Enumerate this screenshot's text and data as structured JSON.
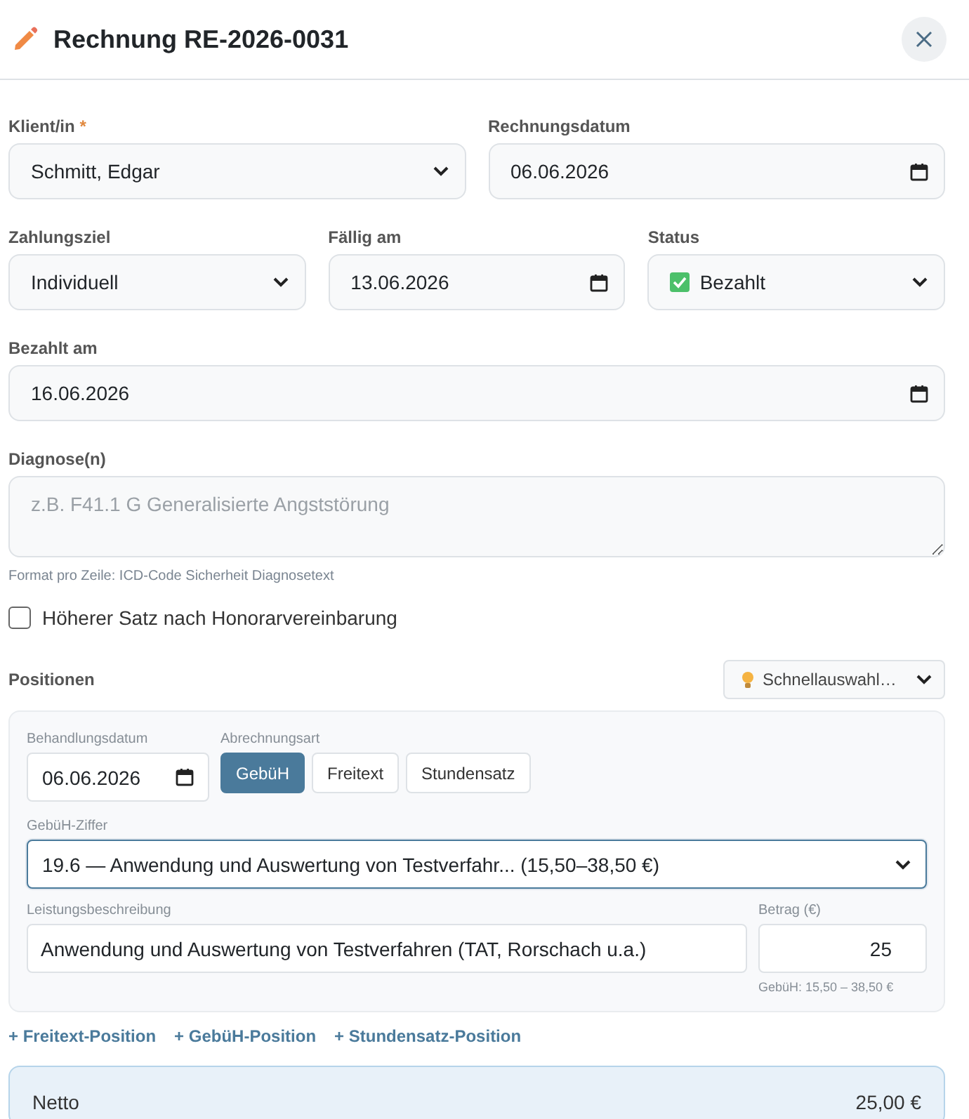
{
  "dialog": {
    "title": "Rechnung RE-2026-0031"
  },
  "required_marker": "*",
  "field_rows": [
    [
      {
        "label": "Klient/in",
        "required": true,
        "kind": "select",
        "value": "Schmitt, Edgar"
      },
      {
        "label": "Rechnungsdatum",
        "required": false,
        "kind": "date",
        "value": "06.06.2026"
      }
    ],
    [
      {
        "label": "Zahlungsziel",
        "required": false,
        "kind": "select",
        "value": "Individuell"
      },
      {
        "label": "Fällig am",
        "required": false,
        "kind": "date",
        "value": "13.06.2026"
      },
      {
        "label": "Status",
        "required": false,
        "kind": "status",
        "value": "Bezahlt"
      }
    ],
    [
      {
        "label": "Bezahlt am",
        "required": false,
        "kind": "date",
        "value": "16.06.2026"
      }
    ]
  ],
  "diagnosis": {
    "label": "Diagnose(n)",
    "placeholder": "z.B. F41.1 G Generalisierte Angststörung",
    "hint": "Format pro Zeile: ICD-Code Sicherheit Diagnosetext"
  },
  "higher_rate": {
    "label": "Höherer Satz nach Honorarvereinbarung",
    "checked": false
  },
  "positions": {
    "title": "Positionen",
    "quick_select": "Schnellauswahl…",
    "items": [
      {
        "date_label": "Behandlungsdatum",
        "date": "06.06.2026",
        "type_label": "Abrechnungsart",
        "types": [
          {
            "label": "GebüH",
            "selected": true
          },
          {
            "label": "Freitext",
            "selected": false
          },
          {
            "label": "Stundensatz",
            "selected": false
          }
        ],
        "code_label": "GebüH-Ziffer",
        "code": "19.6 — Anwendung und Auswertung von Testverfahr... (15,50–38,50 €)",
        "description_label": "Leistungsbeschreibung",
        "description": "Anwendung und Auswertung von Testverfahren (TAT, Rorschach u.a.)",
        "amount_label": "Betrag (€)",
        "amount": "25",
        "amount_hint": "GebüH: 15,50 – 38,50 €"
      }
    ],
    "add_links": [
      "+ Freitext-Position",
      "+ GebüH-Position",
      "+ Stundensatz-Position"
    ]
  },
  "summary": [
    {
      "label": "Netto",
      "value": "25,00 €"
    }
  ]
}
